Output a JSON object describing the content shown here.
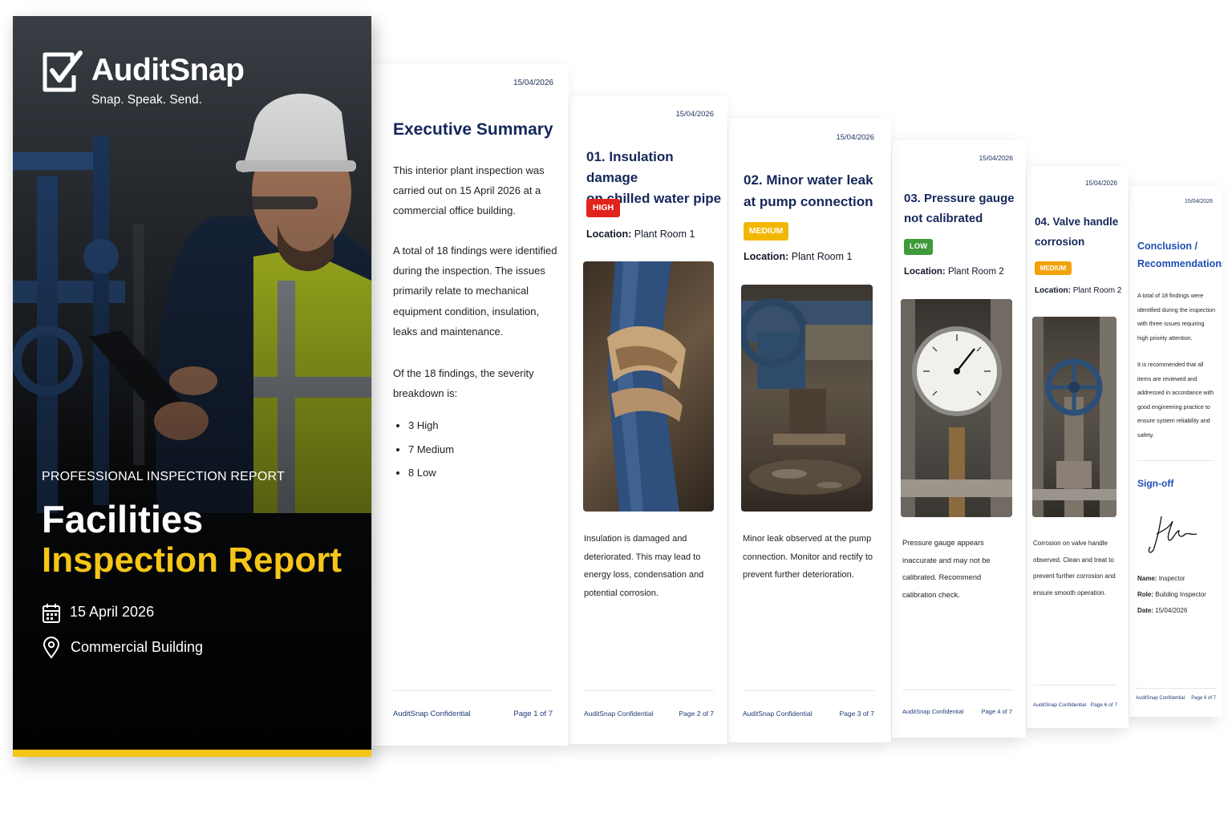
{
  "colors": {
    "high": "#e0241b",
    "medium": "#f2b705",
    "low": "#3e9b3a",
    "navy": "#14275a",
    "accent": "#f5c518"
  },
  "cover": {
    "brand": "AuditSnap",
    "tagline": "Snap. Speak. Send.",
    "kicker": "PROFESSIONAL INSPECTION REPORT",
    "title_line1": "Facilities",
    "title_line2": "Inspection Report",
    "date": "15 April 2026",
    "location": "Commercial Building",
    "icons": [
      "checkbox-logo-icon",
      "calendar-icon",
      "location-pin-icon"
    ]
  },
  "pages": [
    {
      "date": "15/04/2026",
      "title": "Executive Summary",
      "paragraphs": [
        "This interior plant inspection was carried out on 15 April 2026 at a commercial office building.",
        "A total of 18 findings were identified during the inspection. The issues primarily relate to mechanical equipment condition, insulation, leaks and maintenance.",
        "Of the 18 findings, the severity breakdown is:"
      ],
      "bullets": [
        "3 High",
        "7 Medium",
        "8 Low"
      ],
      "footer_left": "AuditSnap Confidential",
      "footer_right": "Page 1 of 7"
    },
    {
      "date": "15/04/2026",
      "title_line1": "01. Insulation damage",
      "title_line2": "on chilled water pipe",
      "severity": "HIGH",
      "location_label": "Location:",
      "location": "Plant Room 1",
      "photo": "insulation-damage-photo",
      "body": "Insulation is damaged and deteriorated. This may lead to energy loss, condensation and potential corrosion.",
      "footer_left": "AuditSnap Confidential",
      "footer_right": "Page 2 of 7"
    },
    {
      "date": "15/04/2026",
      "title_line1": "02. Minor water leak",
      "title_line2": "at pump connection",
      "severity": "MEDIUM",
      "location_label": "Location:",
      "location": "Plant Room 1",
      "photo": "water-leak-photo",
      "body": "Minor leak observed at the pump connection. Monitor and rectify to prevent further deterioration.",
      "footer_left": "AuditSnap Confidential",
      "footer_right": "Page 3 of 7"
    },
    {
      "date": "15/04/2026",
      "title_line1": "03. Pressure gauge",
      "title_line2": "not calibrated",
      "severity": "LOW",
      "location_label": "Location:",
      "location": "Plant Room 2",
      "photo": "pressure-gauge-photo",
      "body": "Pressure gauge appears inaccurate and may not be calibrated. Recommend calibration check.",
      "footer_left": "AuditSnap Confidential",
      "footer_right": "Page 4 of 7"
    },
    {
      "date": "15/04/2026",
      "title_line1": "04. Valve handle",
      "title_line2": "corrosion",
      "severity": "MEDIUM",
      "location_label": "Location:",
      "location": "Plant Room 2",
      "photo": "valve-corrosion-photo",
      "body": "Corrosion on valve handle observed. Clean and treat to prevent further corrosion and ensure smooth operation.",
      "footer_left": "AuditSnap Confidential",
      "footer_right": "Page 6 of 7"
    },
    {
      "date": "15/04/2026",
      "title_line1": "Conclusion /",
      "title_line2": "Recommendations",
      "paragraphs": [
        "A total of 18 findings were identified during the inspection with three issues requiring high priority attention.",
        "It is recommended that all items are reviewed and addressed in accordance with good engineering practice to ensure system reliability and safety."
      ],
      "signoff_title": "Sign-off",
      "name_label": "Name:",
      "name": "Inspector",
      "role_label": "Role:",
      "role": "Building Inspector",
      "date_label": "Date:",
      "signoff_date": "15/04/2026",
      "footer_left": "AuditSnap Confidential",
      "footer_right": "Page 6 of 7"
    }
  ]
}
